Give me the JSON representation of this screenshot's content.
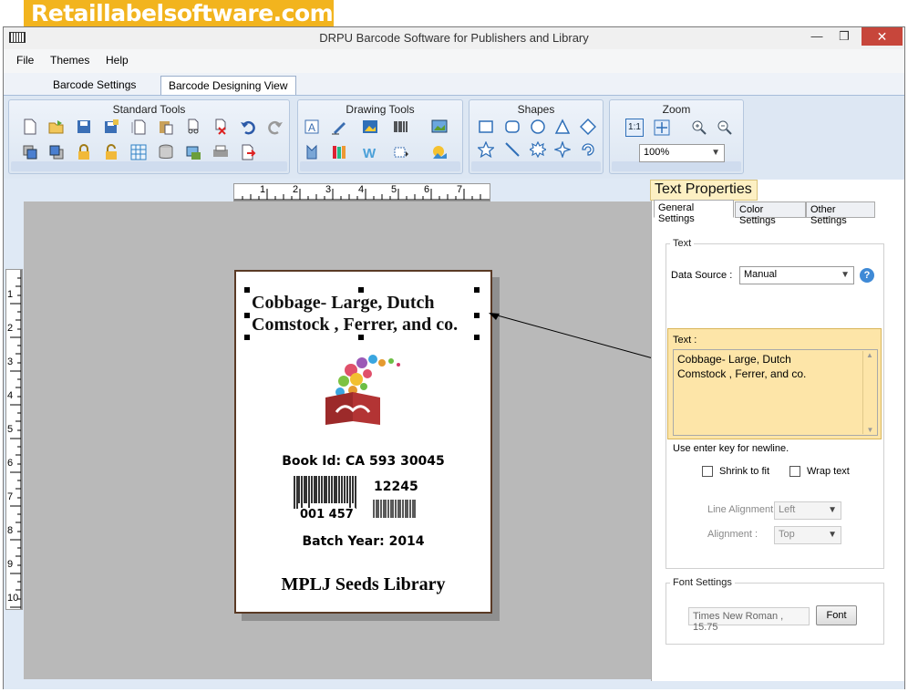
{
  "banner": "Retaillabelsoftware.com",
  "window": {
    "title": "DRPU Barcode Software for Publishers and Library",
    "min": "—",
    "max": "❒",
    "close": "✕"
  },
  "menu": [
    "File",
    "Themes",
    "Help"
  ],
  "tabs": {
    "settings": "Barcode Settings",
    "designing": "Barcode Designing View"
  },
  "ribbon": {
    "standard": "Standard Tools",
    "drawing": "Drawing Tools",
    "shapes": "Shapes",
    "zoom": "Zoom",
    "zoom_value": "100%",
    "zoom_1to1": "1:1"
  },
  "ruler": {
    "h": [
      "1",
      "2",
      "3",
      "4",
      "5",
      "6",
      "7"
    ],
    "v": [
      "1",
      "2",
      "3",
      "4",
      "5",
      "6",
      "7",
      "8",
      "9",
      "10"
    ]
  },
  "label": {
    "heading_line1": "Cobbage- Large, Dutch",
    "heading_line2": "Comstock , Ferrer, and co.",
    "book_id": "Book Id:  CA 593 30045",
    "barcode1_text": "001 457",
    "barcode2_text": "12245",
    "batch_year": "Batch Year:  2014",
    "library": "MPLJ Seeds Library"
  },
  "panel": {
    "title": "Text Properties",
    "tabs": [
      "General Settings",
      "Color Settings",
      "Other Settings"
    ],
    "text_group": "Text",
    "data_source_label": "Data Source :",
    "data_source_value": "Manual",
    "help": "?",
    "text_label": "Text :",
    "text_value": "Cobbage- Large, Dutch\nComstock , Ferrer, and co.",
    "hint": "Use enter key for newline.",
    "shrink": "Shrink to fit",
    "wrap": "Wrap text",
    "line_align_label": "Line Alignment",
    "line_align_value": "Left",
    "align_label": "Alignment :",
    "align_value": "Top",
    "font_group": "Font Settings",
    "font_value": "Times New Roman , 15.75",
    "font_button": "Font"
  },
  "colors": {
    "accent": "#f2b41e",
    "close": "#c7463b",
    "label_border": "#5a3a25",
    "text_highlight": "#fde5a8"
  }
}
